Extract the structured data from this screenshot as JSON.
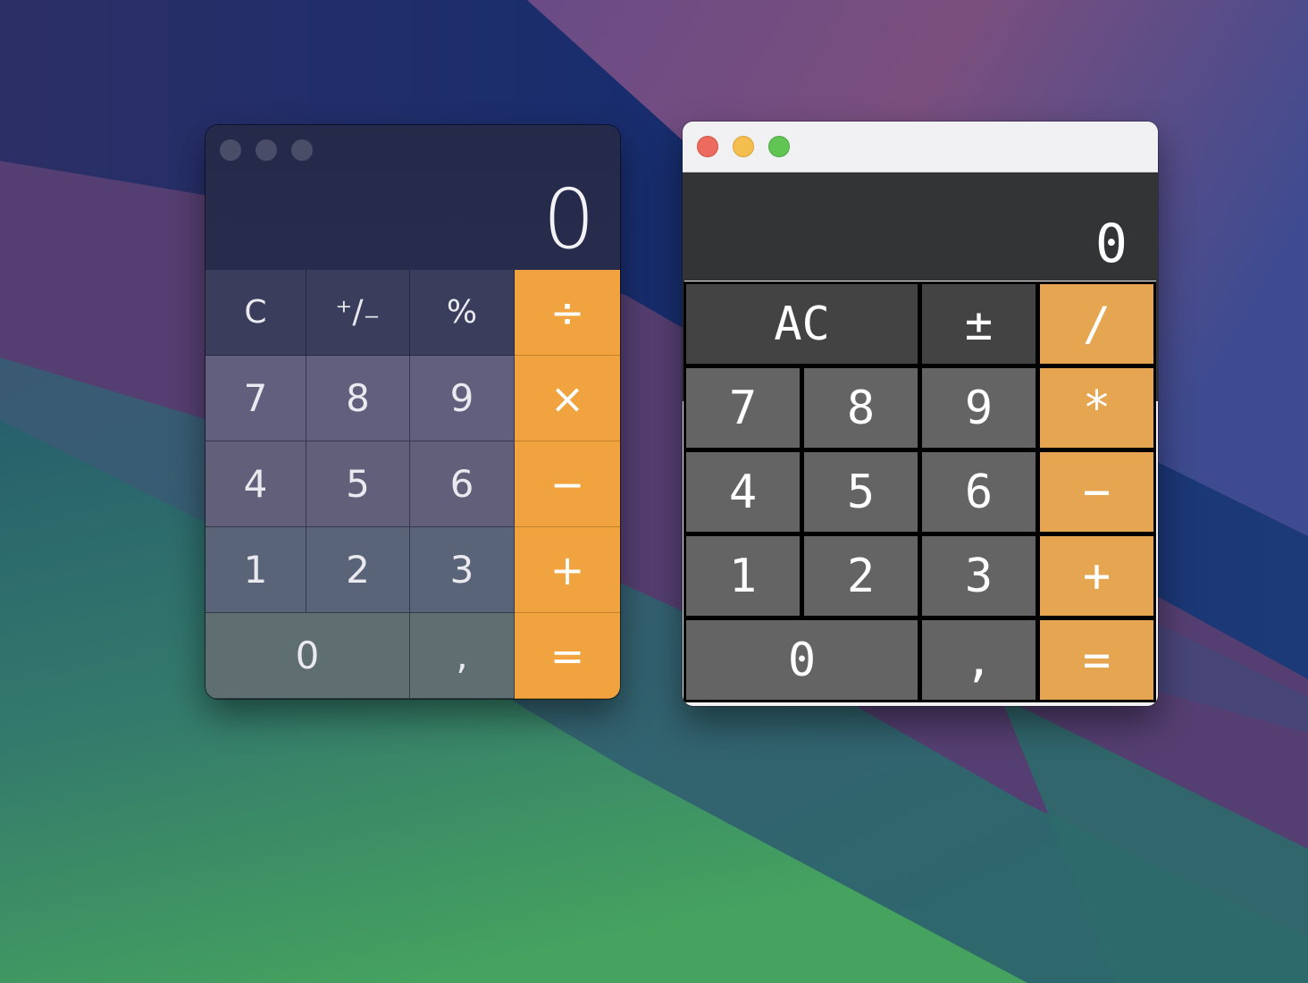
{
  "colors": {
    "accent_orange": "#f0a33e",
    "tk_orange": "#e6a551",
    "tk_display_bg": "#333435",
    "traffic_red": "#ec6a5e",
    "traffic_yellow": "#f4bf4f",
    "traffic_green": "#61c554"
  },
  "window_native": {
    "display_value": "0",
    "keys": [
      {
        "label": "C",
        "name": "key-clear",
        "kind": "fn"
      },
      {
        "label": "⁺∕₋",
        "name": "key-plus-minus",
        "kind": "fn"
      },
      {
        "label": "%",
        "name": "key-percent",
        "kind": "fn"
      },
      {
        "label": "÷",
        "name": "key-divide",
        "kind": "op"
      },
      {
        "label": "7",
        "name": "key-7",
        "kind": "num",
        "row": 2
      },
      {
        "label": "8",
        "name": "key-8",
        "kind": "num",
        "row": 2
      },
      {
        "label": "9",
        "name": "key-9",
        "kind": "num",
        "row": 2
      },
      {
        "label": "×",
        "name": "key-multiply",
        "kind": "op"
      },
      {
        "label": "4",
        "name": "key-4",
        "kind": "num",
        "row": 3
      },
      {
        "label": "5",
        "name": "key-5",
        "kind": "num",
        "row": 3
      },
      {
        "label": "6",
        "name": "key-6",
        "kind": "num",
        "row": 3
      },
      {
        "label": "−",
        "name": "key-minus",
        "kind": "op"
      },
      {
        "label": "1",
        "name": "key-1",
        "kind": "num",
        "row": 4
      },
      {
        "label": "2",
        "name": "key-2",
        "kind": "num",
        "row": 4
      },
      {
        "label": "3",
        "name": "key-3",
        "kind": "num",
        "row": 4
      },
      {
        "label": "+",
        "name": "key-plus",
        "kind": "op"
      },
      {
        "label": "0",
        "name": "key-0",
        "kind": "num",
        "row": 5,
        "wide": true
      },
      {
        "label": ",",
        "name": "key-comma",
        "kind": "num",
        "row": 5
      },
      {
        "label": "=",
        "name": "key-equals",
        "kind": "op"
      }
    ]
  },
  "window_tk": {
    "display_value": "0",
    "keys": [
      {
        "label": "AC",
        "name": "key-all-clear",
        "kind": "fn",
        "wide": true
      },
      {
        "label": "±",
        "name": "key-plus-minus",
        "kind": "fn"
      },
      {
        "label": "/",
        "name": "key-divide",
        "kind": "op"
      },
      {
        "label": "7",
        "name": "key-7",
        "kind": "num"
      },
      {
        "label": "8",
        "name": "key-8",
        "kind": "num"
      },
      {
        "label": "9",
        "name": "key-9",
        "kind": "num"
      },
      {
        "label": "*",
        "name": "key-multiply",
        "kind": "op"
      },
      {
        "label": "4",
        "name": "key-4",
        "kind": "num"
      },
      {
        "label": "5",
        "name": "key-5",
        "kind": "num"
      },
      {
        "label": "6",
        "name": "key-6",
        "kind": "num"
      },
      {
        "label": "−",
        "name": "key-minus",
        "kind": "op"
      },
      {
        "label": "1",
        "name": "key-1",
        "kind": "num"
      },
      {
        "label": "2",
        "name": "key-2",
        "kind": "num"
      },
      {
        "label": "3",
        "name": "key-3",
        "kind": "num"
      },
      {
        "label": "+",
        "name": "key-plus",
        "kind": "op"
      },
      {
        "label": "0",
        "name": "key-0",
        "kind": "num",
        "wide": true
      },
      {
        "label": ",",
        "name": "key-comma",
        "kind": "num"
      },
      {
        "label": "=",
        "name": "key-equals",
        "kind": "op"
      }
    ]
  }
}
